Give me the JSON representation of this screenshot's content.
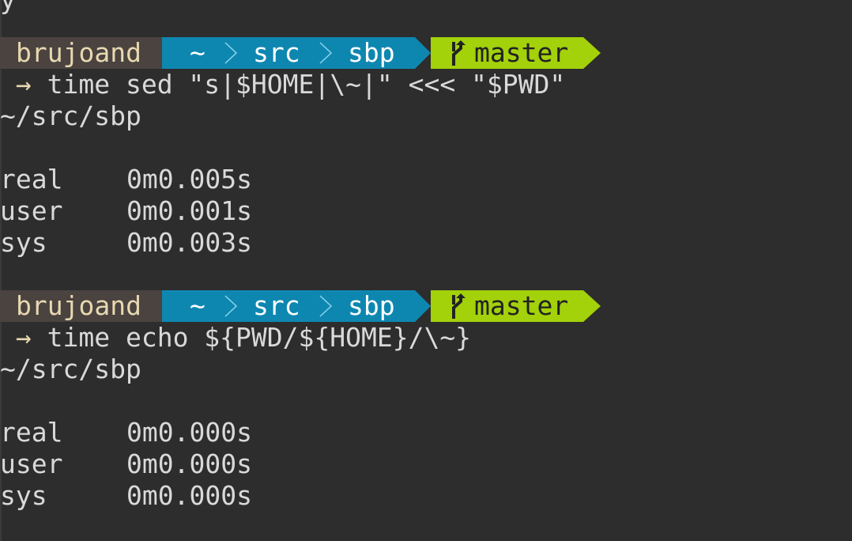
{
  "blocks": [
    {
      "prompt": {
        "user": "brujoand",
        "path": [
          "~",
          "src",
          "sbp"
        ],
        "branch": "master"
      },
      "command": "time sed \"s|$HOME|\\~|\" <<< \"$PWD\"",
      "output": "~/src/sbp",
      "timing": [
        {
          "label": "real",
          "value": "0m0.005s"
        },
        {
          "label": "user",
          "value": "0m0.001s"
        },
        {
          "label": "sys",
          "value": "0m0.003s"
        }
      ]
    },
    {
      "prompt": {
        "user": "brujoand",
        "path": [
          "~",
          "src",
          "sbp"
        ],
        "branch": "master"
      },
      "command": "time echo ${PWD/${HOME}/\\~}",
      "output": "~/src/sbp",
      "timing": [
        {
          "label": "real",
          "value": "0m0.000s"
        },
        {
          "label": "user",
          "value": "0m0.000s"
        },
        {
          "label": "sys",
          "value": "0m0.000s"
        }
      ]
    }
  ],
  "top_fragment": "y",
  "prompt_symbol": "→",
  "icons": {
    "branch": "git-branch-icon",
    "separator": "chevron-right-icon"
  },
  "colors": {
    "background": "#2d2d2d",
    "user_segment": "#4a4340",
    "path_segment": "#0e87b0",
    "git_segment": "#a3d10a",
    "text": "#d9d9d9"
  }
}
